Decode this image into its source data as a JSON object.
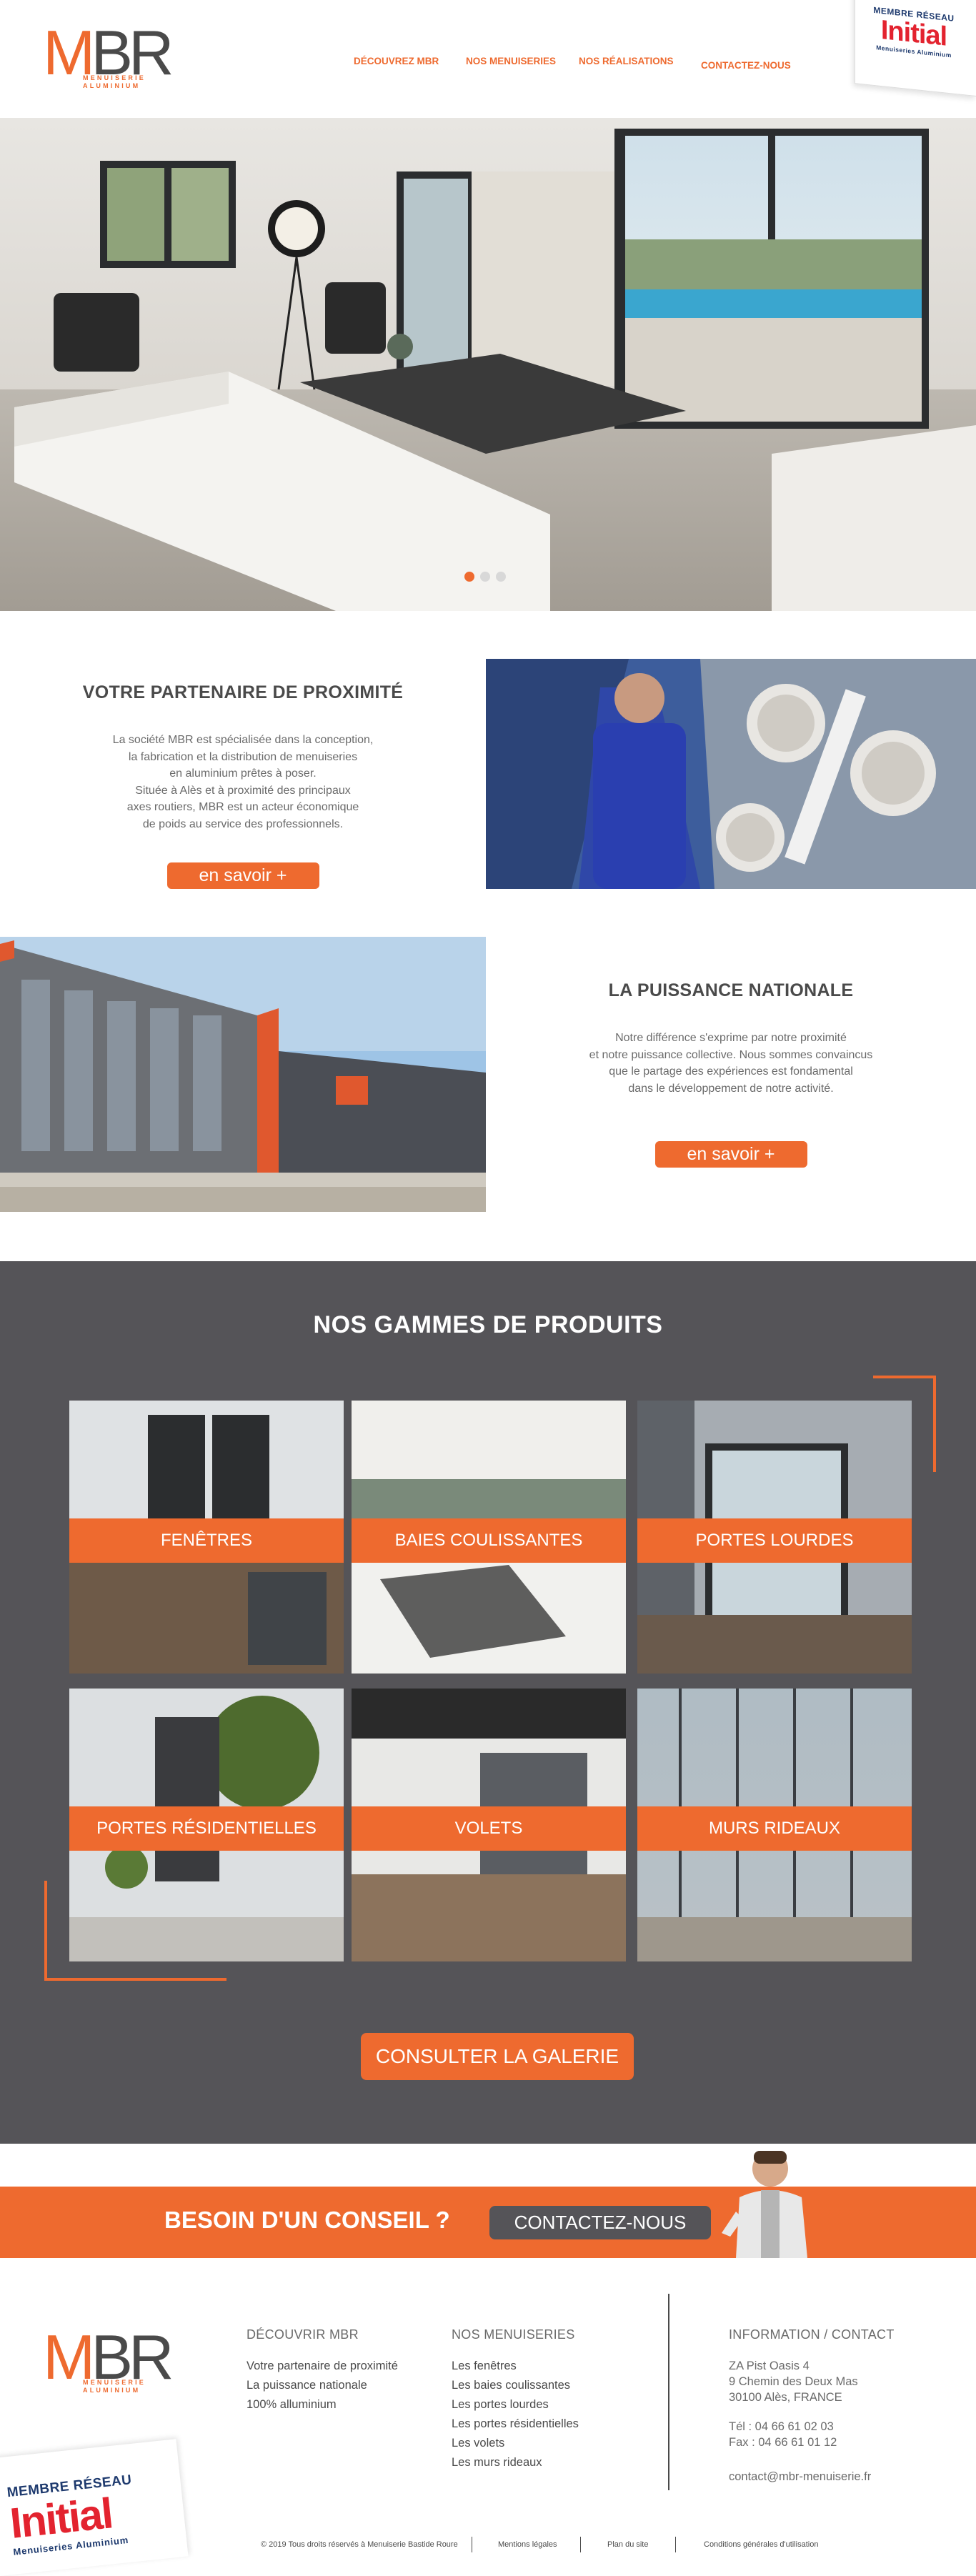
{
  "header": {
    "logo": {
      "letters_m": "M",
      "letters_br": "BR",
      "sub1": "MENUISERIE",
      "sub2": "ALUMINIUM"
    },
    "nav": [
      {
        "label": "DÉCOUVREZ MBR"
      },
      {
        "label": "NOS MENUISERIES"
      },
      {
        "label": "NOS RÉALISATIONS"
      },
      {
        "label": "CONTACTEZ-NOUS"
      }
    ],
    "badge": {
      "small": "MEMBRE RÉSEAU",
      "brand": "Initial",
      "sub": "Menuiseries Aluminium"
    }
  },
  "hero": {
    "slide_count": 3,
    "active_slide": 1
  },
  "partner": {
    "title": "VOTRE PARTENAIRE DE PROXIMITÉ",
    "body": [
      "La société MBR est spécialisée dans la conception,",
      "la fabrication et la distribution de menuiseries",
      "en aluminium prêtes à poser.",
      "Située à Alès et à proximité des principaux",
      "axes routiers, MBR est un acteur économique",
      "de poids au service des professionnels."
    ],
    "button": "en savoir +"
  },
  "national": {
    "title": "LA PUISSANCE NATIONALE",
    "body": [
      "Notre différence s'exprime par notre proximité",
      "et notre puissance collective. Nous sommes convaincus",
      "que le partage des expériences est fondamental",
      "dans le développement de notre activité."
    ],
    "button": "en savoir +"
  },
  "gammes": {
    "title": "NOS GAMMES DE PRODUITS",
    "tiles": [
      {
        "label": "FENÊTRES"
      },
      {
        "label": "BAIES COULISSANTES"
      },
      {
        "label": "PORTES LOURDES"
      },
      {
        "label": "PORTES RÉSIDENTIELLES"
      },
      {
        "label": "VOLETS"
      },
      {
        "label": "MURS RIDEAUX"
      }
    ],
    "button": "CONSULTER LA GALERIE"
  },
  "conseil": {
    "question": "BESOIN D'UN CONSEIL ?",
    "button": "CONTACTEZ-NOUS"
  },
  "footer": {
    "col1": {
      "title": "DÉCOUVRIR MBR",
      "links": [
        "Votre partenaire de proximité",
        "La puissance nationale",
        "100% alluminium"
      ]
    },
    "col2": {
      "title": "NOS MENUISERIES",
      "links": [
        "Les fenêtres",
        "Les baies coulissantes",
        "Les portes lourdes",
        "Les portes résidentielles",
        "Les volets",
        "Les murs rideaux"
      ]
    },
    "col3": {
      "title": "INFORMATION / CONTACT",
      "address": [
        "ZA Pist Oasis 4",
        "9 Chemin des Deux Mas",
        "30100 Alès, FRANCE"
      ],
      "tel": "Tél : 04 66 61 02 03",
      "fax": "Fax : 04 66 61 01 12",
      "email": "contact@mbr-menuiserie.fr"
    },
    "bottom": [
      "© 2019 Tous droits réservés à Menuiserie Bastide Roure",
      "Mentions légales",
      "Plan du site",
      "Conditions générales d'utilisation"
    ],
    "badge": {
      "small": "MEMBRE RÉSEAU",
      "brand": "Initial",
      "sub": "Menuiseries Aluminium"
    }
  },
  "colors": {
    "accent": "#ee6a2f",
    "dark": "#555458",
    "text": "#4a4a4a",
    "initial_red": "#e3232f",
    "initial_blue": "#1e3a6e"
  }
}
